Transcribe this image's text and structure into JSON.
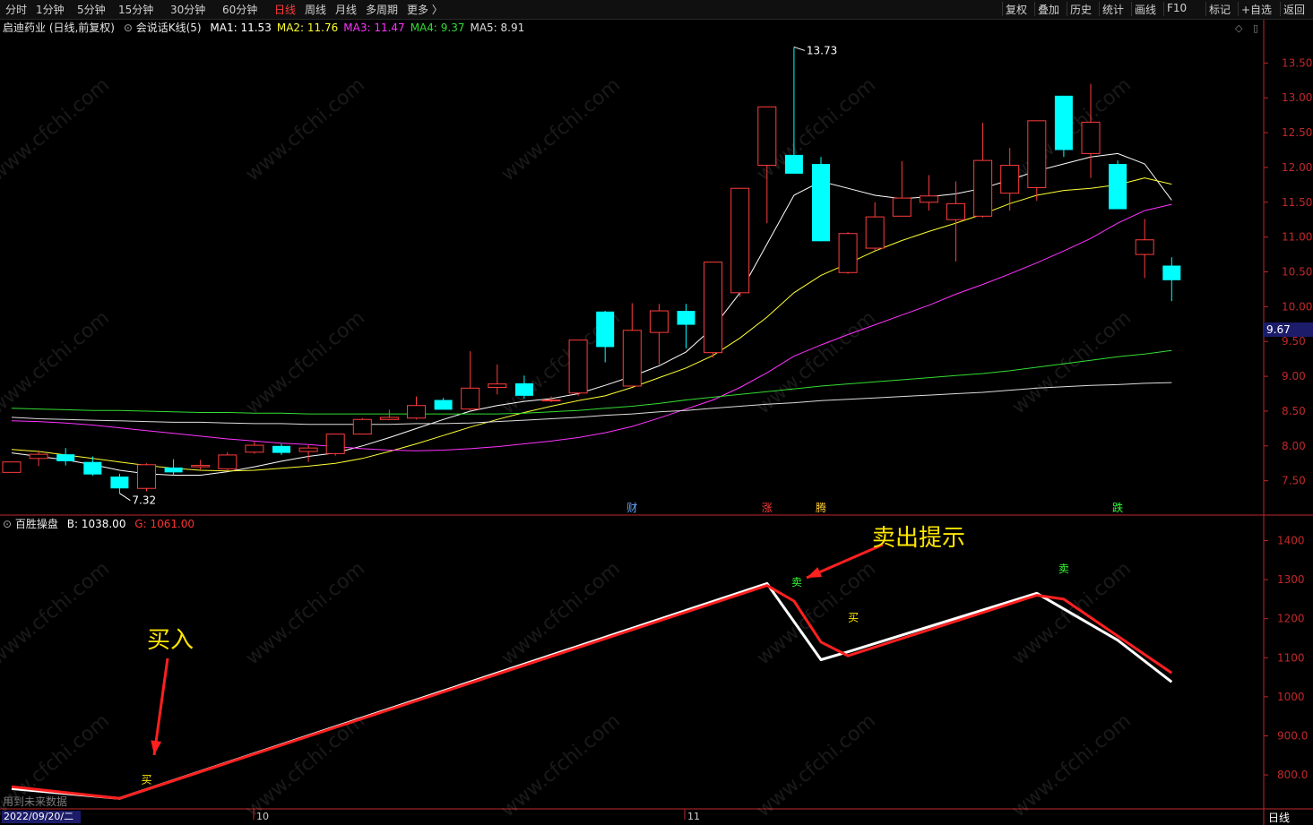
{
  "toolbar": {
    "left_items": [
      "分时",
      "1分钟",
      "5分钟",
      "15分钟",
      "30分钟",
      "60分钟",
      "日线",
      "周线",
      "月线",
      "多周期",
      "更多 〉"
    ],
    "active": "日线",
    "right_items": [
      "复权",
      "叠加",
      "历史",
      "统计",
      "画线",
      "F10",
      "标记",
      "+自选",
      "返回"
    ]
  },
  "header": {
    "stock": "启迪药业 (日线,前复权)",
    "indicator": "会说话K线(5)",
    "ma": [
      {
        "label": "MA1: 11.53",
        "color": "#ffffff"
      },
      {
        "label": "MA2: 11.76",
        "color": "#ffff33"
      },
      {
        "label": "MA3: 11.47",
        "color": "#ff33ff"
      },
      {
        "label": "MA4: 9.37",
        "color": "#33dd33"
      },
      {
        "label": "MA5: 8.91",
        "color": "#dddddd"
      }
    ]
  },
  "indicator_header": {
    "name": "百胜操盘",
    "b": "B: 1038.00",
    "g": "G: 1061.00"
  },
  "annotations": {
    "buy": "买入",
    "sell": "卖出提示"
  },
  "notes": {
    "bottom_left": "用到未来数据",
    "date": "2022/09/20/二",
    "period": "日线"
  },
  "colors": {
    "up": "#ff3c3c",
    "down": "#00ffff",
    "axis": "#c0282a",
    "ma1": "#ffffff",
    "ma2": "#ffff33",
    "ma3": "#ff33ff",
    "ma4": "#33dd33",
    "ma5": "#dddddd"
  },
  "chart_data": [
    {
      "type": "candlestick",
      "title": "启迪药业 (日线,前复权)",
      "ylim": [
        7.2,
        13.8
      ],
      "y_ticks": [
        "13.50",
        "13.00",
        "12.50",
        "12.00",
        "11.50",
        "11.00",
        "10.50",
        "10.00",
        "9.50",
        "9.00",
        "8.50",
        "8.00",
        "7.50"
      ],
      "x_ticks": [
        "10",
        "11"
      ],
      "current_price": "9.67",
      "high_label": "13.73",
      "low_label": "7.32",
      "candles": [
        {
          "o": 7.62,
          "h": 7.75,
          "l": 7.62,
          "c": 7.77
        },
        {
          "o": 7.82,
          "h": 7.92,
          "l": 7.71,
          "c": 7.88
        },
        {
          "o": 7.88,
          "h": 7.97,
          "l": 7.72,
          "c": 7.78
        },
        {
          "o": 7.77,
          "h": 7.85,
          "l": 7.57,
          "c": 7.59
        },
        {
          "o": 7.56,
          "h": 7.6,
          "l": 7.32,
          "c": 7.39
        },
        {
          "o": 7.39,
          "h": 7.75,
          "l": 7.35,
          "c": 7.73
        },
        {
          "o": 7.69,
          "h": 7.81,
          "l": 7.58,
          "c": 7.62
        },
        {
          "o": 7.7,
          "h": 7.8,
          "l": 7.66,
          "c": 7.72
        },
        {
          "o": 7.67,
          "h": 7.91,
          "l": 7.64,
          "c": 7.87
        },
        {
          "o": 7.91,
          "h": 8.06,
          "l": 7.89,
          "c": 8.01
        },
        {
          "o": 8.0,
          "h": 8.03,
          "l": 7.87,
          "c": 7.9
        },
        {
          "o": 7.92,
          "h": 8.01,
          "l": 7.77,
          "c": 7.97
        },
        {
          "o": 7.89,
          "h": 8.17,
          "l": 7.86,
          "c": 8.17
        },
        {
          "o": 8.17,
          "h": 8.4,
          "l": 8.17,
          "c": 8.38
        },
        {
          "o": 8.38,
          "h": 8.52,
          "l": 8.37,
          "c": 8.41
        },
        {
          "o": 8.4,
          "h": 8.71,
          "l": 8.38,
          "c": 8.58
        },
        {
          "o": 8.66,
          "h": 8.69,
          "l": 8.52,
          "c": 8.52
        },
        {
          "o": 8.53,
          "h": 9.36,
          "l": 8.51,
          "c": 8.83
        },
        {
          "o": 8.84,
          "h": 9.17,
          "l": 8.74,
          "c": 8.89
        },
        {
          "o": 8.9,
          "h": 9.01,
          "l": 8.68,
          "c": 8.72
        },
        {
          "o": 8.66,
          "h": 8.71,
          "l": 8.63,
          "c": 8.66
        },
        {
          "o": 8.76,
          "h": 9.48,
          "l": 8.72,
          "c": 9.52
        },
        {
          "o": 9.93,
          "h": 9.94,
          "l": 9.2,
          "c": 9.42
        },
        {
          "o": 8.86,
          "h": 10.05,
          "l": 8.86,
          "c": 9.66
        },
        {
          "o": 9.63,
          "h": 10.04,
          "l": 9.17,
          "c": 9.94
        },
        {
          "o": 9.94,
          "h": 10.04,
          "l": 9.4,
          "c": 9.74
        },
        {
          "o": 9.34,
          "h": 10.64,
          "l": 9.27,
          "c": 10.64
        },
        {
          "o": 10.2,
          "h": 11.7,
          "l": 10.14,
          "c": 11.7
        },
        {
          "o": 12.03,
          "h": 12.87,
          "l": 11.2,
          "c": 12.87
        },
        {
          "o": 12.18,
          "h": 13.73,
          "l": 11.91,
          "c": 11.91
        },
        {
          "o": 12.05,
          "h": 12.15,
          "l": 10.94,
          "c": 10.94
        },
        {
          "o": 10.49,
          "h": 11.07,
          "l": 10.47,
          "c": 11.05
        },
        {
          "o": 10.84,
          "h": 11.5,
          "l": 10.81,
          "c": 11.29
        },
        {
          "o": 11.3,
          "h": 12.09,
          "l": 11.3,
          "c": 11.56
        },
        {
          "o": 11.5,
          "h": 11.89,
          "l": 11.38,
          "c": 11.59
        },
        {
          "o": 11.25,
          "h": 11.8,
          "l": 10.65,
          "c": 11.48
        },
        {
          "o": 11.3,
          "h": 12.64,
          "l": 11.28,
          "c": 12.1
        },
        {
          "o": 11.63,
          "h": 12.28,
          "l": 11.38,
          "c": 12.03
        },
        {
          "o": 11.71,
          "h": 12.66,
          "l": 11.52,
          "c": 12.67
        },
        {
          "o": 13.03,
          "h": 13.03,
          "l": 12.15,
          "c": 12.25
        },
        {
          "o": 12.2,
          "h": 13.2,
          "l": 11.85,
          "c": 12.65
        },
        {
          "o": 12.05,
          "h": 12.1,
          "l": 11.4,
          "c": 11.4
        },
        {
          "o": 10.75,
          "h": 11.26,
          "l": 10.41,
          "c": 10.96
        },
        {
          "o": 10.59,
          "h": 10.71,
          "l": 10.08,
          "c": 10.38
        }
      ],
      "series": [
        {
          "name": "MA1",
          "values": [
            7.9,
            7.85,
            7.8,
            7.73,
            7.65,
            7.6,
            7.58,
            7.58,
            7.63,
            7.7,
            7.78,
            7.85,
            7.9,
            8.0,
            8.12,
            8.25,
            8.38,
            8.5,
            8.58,
            8.64,
            8.68,
            8.75,
            8.87,
            9.0,
            9.15,
            9.35,
            9.7,
            10.2,
            10.9,
            11.6,
            11.8,
            11.7,
            11.6,
            11.55,
            11.58,
            11.62,
            11.7,
            11.82,
            11.95,
            12.05,
            12.15,
            12.2,
            12.05,
            11.53
          ]
        },
        {
          "name": "MA2",
          "values": [
            7.95,
            7.92,
            7.87,
            7.82,
            7.77,
            7.72,
            7.68,
            7.65,
            7.64,
            7.65,
            7.68,
            7.71,
            7.75,
            7.82,
            7.92,
            8.03,
            8.15,
            8.27,
            8.38,
            8.48,
            8.57,
            8.65,
            8.72,
            8.84,
            8.98,
            9.12,
            9.3,
            9.55,
            9.85,
            10.2,
            10.45,
            10.62,
            10.8,
            10.95,
            11.08,
            11.2,
            11.33,
            11.48,
            11.6,
            11.67,
            11.7,
            11.75,
            11.85,
            11.76
          ]
        },
        {
          "name": "MA3",
          "values": [
            8.36,
            8.35,
            8.33,
            8.3,
            8.26,
            8.22,
            8.18,
            8.14,
            8.1,
            8.07,
            8.04,
            8.02,
            7.99,
            7.96,
            7.94,
            7.93,
            7.94,
            7.96,
            7.99,
            8.03,
            8.07,
            8.12,
            8.19,
            8.28,
            8.4,
            8.53,
            8.66,
            8.84,
            9.05,
            9.29,
            9.45,
            9.6,
            9.74,
            9.88,
            10.02,
            10.18,
            10.32,
            10.47,
            10.63,
            10.8,
            10.98,
            11.2,
            11.38,
            11.47
          ]
        },
        {
          "name": "MA4",
          "values": [
            8.54,
            8.53,
            8.52,
            8.51,
            8.51,
            8.5,
            8.49,
            8.48,
            8.48,
            8.47,
            8.47,
            8.46,
            8.46,
            8.46,
            8.46,
            8.46,
            8.46,
            8.46,
            8.46,
            8.47,
            8.49,
            8.51,
            8.54,
            8.57,
            8.61,
            8.66,
            8.7,
            8.74,
            8.78,
            8.82,
            8.86,
            8.89,
            8.92,
            8.95,
            8.98,
            9.01,
            9.04,
            9.08,
            9.13,
            9.18,
            9.23,
            9.28,
            9.32,
            9.37
          ]
        },
        {
          "name": "MA5",
          "values": [
            8.41,
            8.39,
            8.38,
            8.37,
            8.36,
            8.35,
            8.34,
            8.34,
            8.33,
            8.32,
            8.32,
            8.31,
            8.31,
            8.31,
            8.31,
            8.32,
            8.32,
            8.33,
            8.35,
            8.37,
            8.39,
            8.41,
            8.44,
            8.46,
            8.49,
            8.51,
            8.54,
            8.57,
            8.6,
            8.62,
            8.65,
            8.67,
            8.69,
            8.71,
            8.73,
            8.75,
            8.77,
            8.8,
            8.83,
            8.85,
            8.87,
            8.88,
            8.9,
            8.91
          ]
        }
      ],
      "event_markers": [
        {
          "index": 23,
          "text": "财",
          "color": "#66aaff"
        },
        {
          "index": 28,
          "text": "涨",
          "color": "#ff3c3c"
        },
        {
          "index": 30,
          "text": "腾",
          "color": "#ffcc33"
        },
        {
          "index": 41,
          "text": "跌",
          "color": "#33ff33"
        }
      ]
    },
    {
      "type": "line",
      "title": "百胜操盘",
      "ylim": [
        720,
        1440
      ],
      "y_ticks": [
        "1400",
        "1300",
        "1200",
        "1100",
        "1000",
        "900.0",
        "800.0"
      ],
      "series": [
        {
          "name": "B",
          "color": "#ffffff",
          "x": [
            0,
            4,
            28,
            30,
            31,
            38,
            41,
            43
          ],
          "values": [
            765,
            740,
            1290,
            1095,
            1115,
            1265,
            1145,
            1038
          ]
        },
        {
          "name": "G",
          "color": "#ff2020",
          "x": [
            0,
            4,
            28,
            29,
            30,
            31,
            38,
            39,
            43
          ],
          "values": [
            770,
            740,
            1285,
            1245,
            1140,
            1105,
            1260,
            1250,
            1061
          ]
        }
      ],
      "signal_markers": [
        {
          "x": 5,
          "y": 790,
          "text": "买",
          "color": "#ffe600"
        },
        {
          "x": 29.1,
          "y": 1295,
          "text": "卖",
          "color": "#33ff33"
        },
        {
          "x": 31.2,
          "y": 1205,
          "text": "买",
          "color": "#ffe600"
        },
        {
          "x": 39,
          "y": 1330,
          "text": "卖",
          "color": "#33ff33"
        }
      ]
    }
  ]
}
